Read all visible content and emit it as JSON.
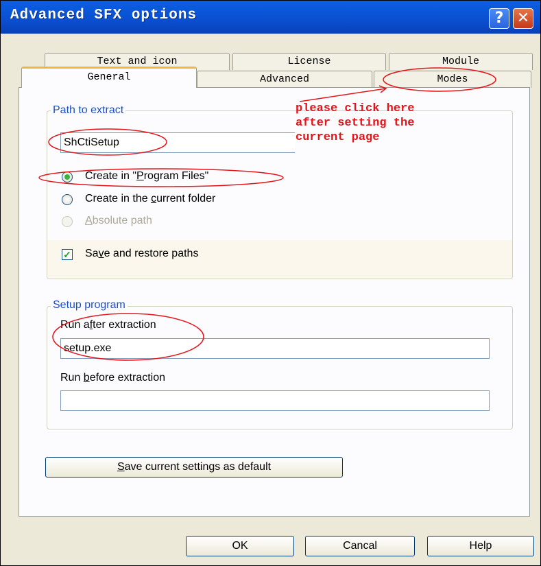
{
  "window": {
    "title": "Advanced SFX options",
    "help_icon": "question-mark-icon",
    "close_icon": "close-x-icon"
  },
  "tabs": {
    "back_row": [
      "Text and icon",
      "License",
      "Module"
    ],
    "front_row": [
      "General",
      "Advanced",
      "Modes"
    ],
    "active": "General"
  },
  "path_group": {
    "label": "Path to extract",
    "input_value": "ShCtiSetup",
    "radio_program_files_a": "Create in \"",
    "radio_program_files_u": "P",
    "radio_program_files_b": "rogram Files\"",
    "radio_current_a": "Create in the ",
    "radio_current_u": "c",
    "radio_current_b": "urrent folder",
    "radio_absolute_u": "A",
    "radio_absolute_b": "bsolute path",
    "save_restore_a": "Sa",
    "save_restore_u": "v",
    "save_restore_b": "e and restore paths",
    "save_restore_checked": true
  },
  "annotation": {
    "text": "please click here\nafter setting the\ncurrent page",
    "color": "#e4141a"
  },
  "setup_group": {
    "label": "Setup program",
    "run_after_a": "Run a",
    "run_after_u": "f",
    "run_after_b": "ter extraction",
    "run_after_value": "setup.exe",
    "run_before_a": "Run ",
    "run_before_u": "b",
    "run_before_b": "efore extraction",
    "run_before_value": ""
  },
  "save_default_u": "S",
  "save_default_b": "ave current settings as default",
  "footer": {
    "ok": "OK",
    "cancel": "Cancal",
    "help": "Help"
  }
}
